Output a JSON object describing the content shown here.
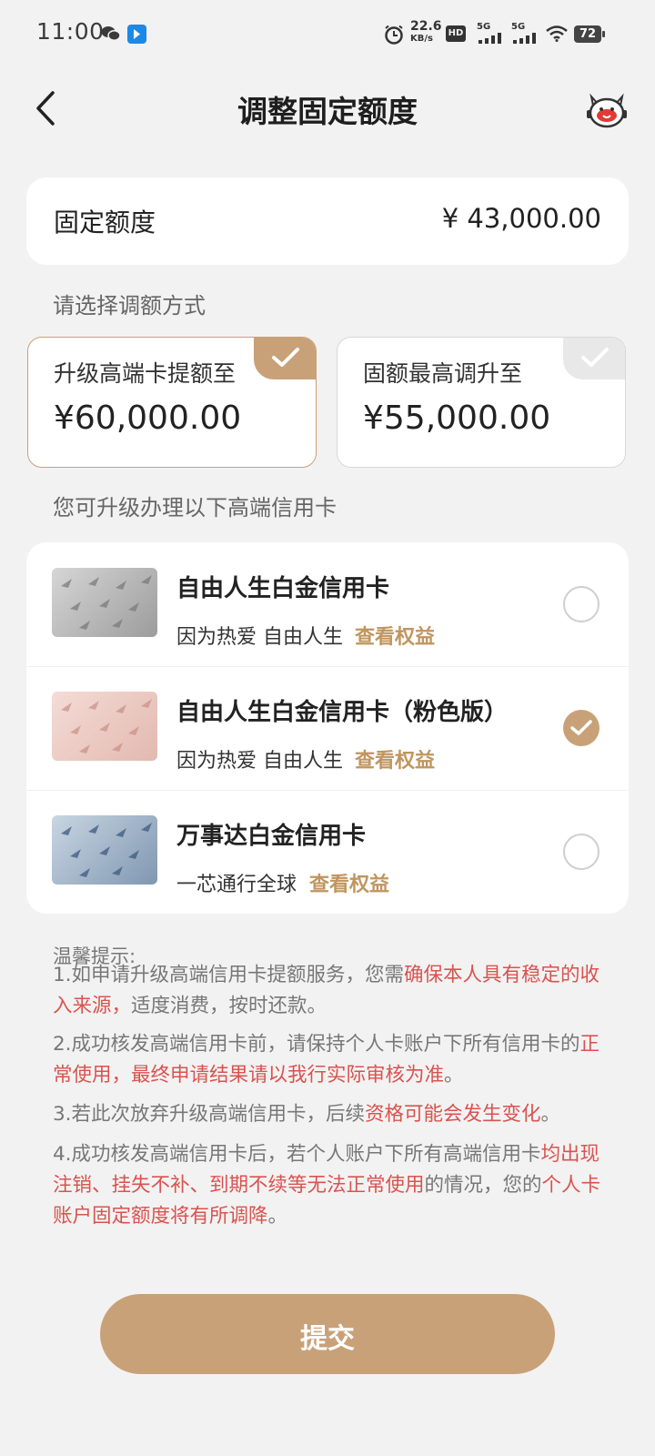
{
  "status_bar": {
    "time": "11:00",
    "net_speed_top": "22.6",
    "net_speed_unit": "KB/s",
    "hd_label": "HD",
    "sig1_label": "5G",
    "sig2_label": "5G",
    "battery": "72",
    "icons": [
      "wechat-icon",
      "app-notify-icon",
      "alarm-icon",
      "wifi-icon",
      "battery-icon"
    ]
  },
  "header": {
    "title": "调整固定额度"
  },
  "fixed_limit": {
    "label": "固定额度",
    "value": "¥ 43,000.00"
  },
  "method_section": {
    "label": "请选择调额方式",
    "options": [
      {
        "title": "升级高端卡提额至",
        "value": "¥60,000.00",
        "selected": true
      },
      {
        "title": "固额最高调升至",
        "value": "¥55,000.00",
        "selected": false
      }
    ]
  },
  "upgrade_section": {
    "label": "您可升级办理以下高端信用卡",
    "cards": [
      {
        "name": "自由人生白金信用卡",
        "slogan": "因为热爱 自由人生",
        "link": "查看权益",
        "selected": false
      },
      {
        "name": "自由人生白金信用卡（粉色版）",
        "slogan": "因为热爱 自由人生",
        "link": "查看权益",
        "selected": true
      },
      {
        "name": "万事达白金信用卡",
        "slogan": "一芯通行全球",
        "link": "查看权益",
        "selected": false
      }
    ]
  },
  "tips": {
    "title": "温馨提示:",
    "t1": {
      "a": "1.如申请升级高端信用卡提额服务，您需",
      "b": "确保本人具有稳定的收入来源，",
      "c": "适度消费，按时还款。"
    },
    "t2": {
      "a": "2.成功核发高端信用卡前，请保持个人卡账户下所有信用卡的",
      "b": "正常使用，最终申请结果请以我行实际审核为准",
      "c": "。"
    },
    "t3": {
      "a": "3.若此次放弃升级高端信用卡，后续",
      "b": "资格可能会发生变化",
      "c": "。"
    },
    "t4": {
      "a": "4.成功核发高端信用卡后，若个人账户下所有高端信用卡",
      "b": "均出现注销、挂失不补、到期不续等无法正常使用",
      "c": "的情况，您的",
      "d": "个人卡账户固定额度将有所调降",
      "e": "。"
    }
  },
  "submit": {
    "label": "提交"
  },
  "colors": {
    "accent": "#c9a178",
    "link": "#c0955f",
    "warning": "#d9534f",
    "background": "#f3f2f2"
  }
}
